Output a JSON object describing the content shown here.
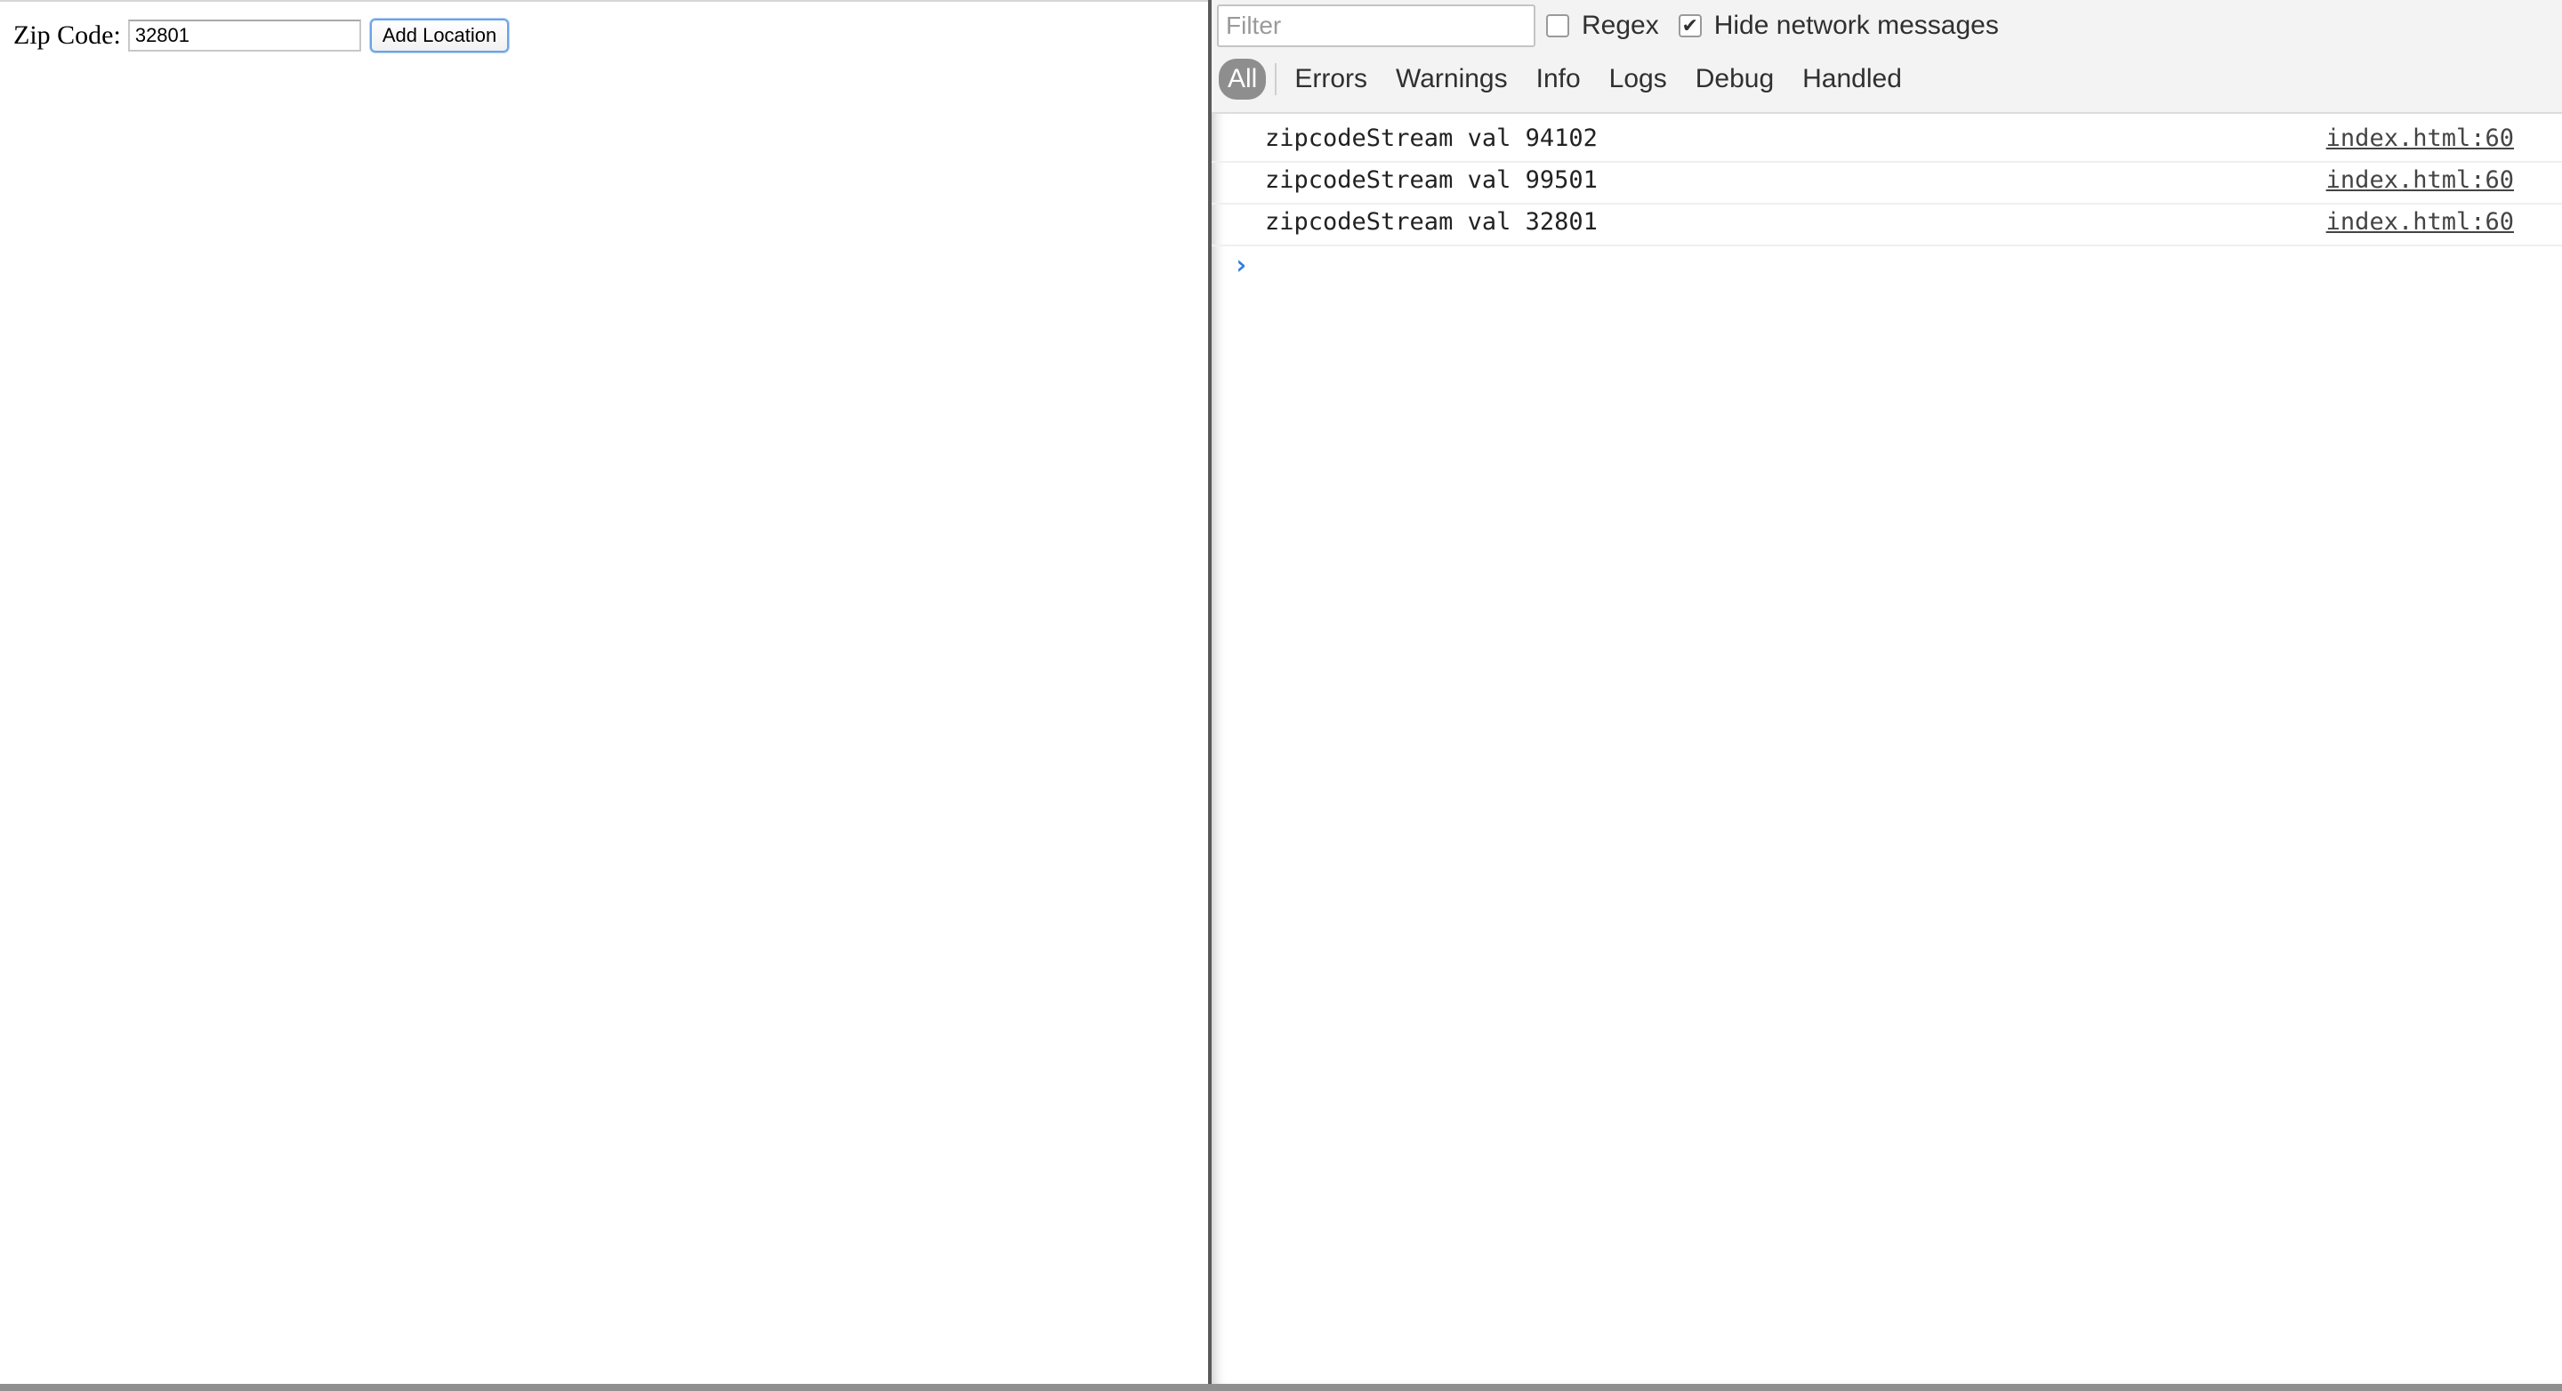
{
  "page": {
    "zip_label": "Zip Code:",
    "zip_value": "32801",
    "add_button_label": "Add Location"
  },
  "devtools": {
    "filter_placeholder": "Filter",
    "regex_label": "Regex",
    "regex_checked": false,
    "hide_network_label": "Hide network messages",
    "hide_network_checked": true,
    "levels": [
      "All",
      "Errors",
      "Warnings",
      "Info",
      "Logs",
      "Debug",
      "Handled"
    ],
    "active_level": "All",
    "messages": [
      {
        "text": "zipcodeStream val 94102",
        "source": "index.html:60"
      },
      {
        "text": "zipcodeStream val 99501",
        "source": "index.html:60"
      },
      {
        "text": "zipcodeStream val 32801",
        "source": "index.html:60"
      }
    ],
    "prompt_glyph": "›"
  },
  "icons": {
    "check_glyph": "✔",
    "prompt_icon": "chevron-right-icon"
  },
  "colors": {
    "prompt_blue": "#2f7de1",
    "button_focus": "#6aa3e8",
    "active_level_bg": "#8e8e8e"
  }
}
